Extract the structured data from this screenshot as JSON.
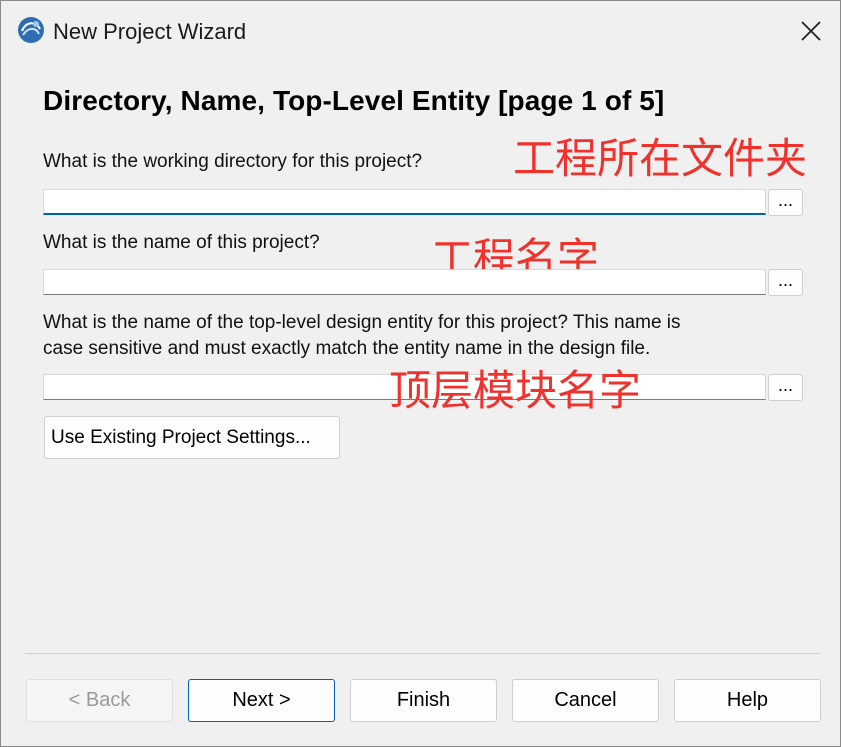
{
  "window": {
    "title": "New Project Wizard",
    "icon": "quartus-app-icon",
    "close_icon": "close-icon"
  },
  "page": {
    "heading": "Directory, Name, Top-Level Entity [page 1 of 5]"
  },
  "fields": {
    "directory": {
      "label": "What is the working directory for this project?",
      "value": "",
      "browse_label": "..."
    },
    "name": {
      "label": "What is the name of this project?",
      "value": "",
      "browse_label": "..."
    },
    "top_entity": {
      "label_line1": "What is the name of the top-level design entity for this project? This name is",
      "label_line2": "case sensitive and must exactly match the entity name in the design file.",
      "value": "",
      "browse_label": "..."
    }
  },
  "annotations": {
    "directory": "工程所在文件夹",
    "name": "工程名字",
    "top_entity": "顶层模块名字",
    "color": "#f0322d"
  },
  "use_existing_label": "Use Existing Project Settings...",
  "footer": {
    "back": "< Back",
    "next": "Next >",
    "finish": "Finish",
    "cancel": "Cancel",
    "help": "Help"
  },
  "colors": {
    "accent": "#005fb8",
    "background": "#f0f0f0"
  }
}
